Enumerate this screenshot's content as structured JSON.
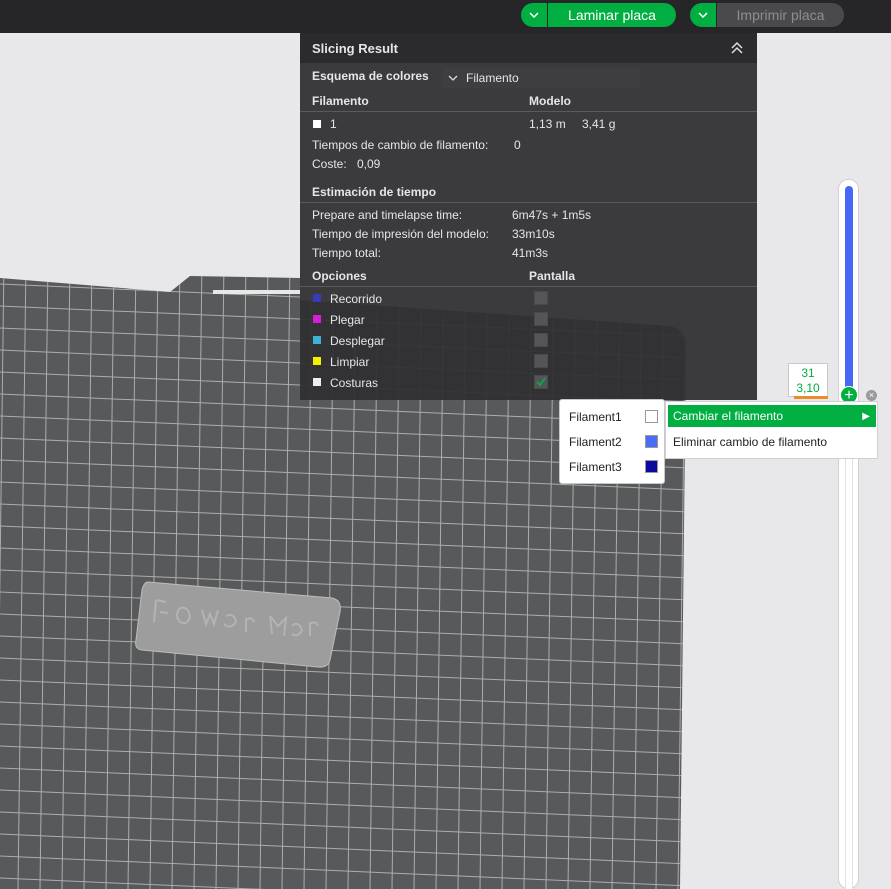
{
  "toolbar": {
    "slice_label": "Laminar placa",
    "print_label": "Imprimir placa"
  },
  "panel": {
    "title": "Slicing Result",
    "color_scheme_label": "Esquema de colores",
    "color_scheme_value": "Filamento",
    "filament_header": "Filamento",
    "model_header": "Modelo",
    "filament_rows": [
      {
        "index": "1",
        "length": "1,13 m",
        "weight": "3,41 g",
        "color": "#ffffff"
      }
    ],
    "change_count_label": "Tiempos de cambio de filamento:",
    "change_count_value": "0",
    "cost_label": "Coste:",
    "cost_value": "0,09",
    "time_section_title": "Estimación de tiempo",
    "times": [
      {
        "label": "Prepare and timelapse time:",
        "value": "6m47s + 1m5s"
      },
      {
        "label": "Tiempo de impresión del modelo:",
        "value": "33m10s"
      },
      {
        "label": "Tiempo total:",
        "value": "41m3s"
      }
    ],
    "options_header": "Opciones",
    "display_header": "Pantalla",
    "options": [
      {
        "label": "Recorrido",
        "color": "#3a3ab8",
        "checked": false
      },
      {
        "label": "Plegar",
        "color": "#d41fd4",
        "checked": false
      },
      {
        "label": "Desplegar",
        "color": "#3fb0d6",
        "checked": false
      },
      {
        "label": "Limpiar",
        "color": "#f2f200",
        "checked": false
      },
      {
        "label": "Costuras",
        "color": "#eeeeee",
        "checked": true
      }
    ]
  },
  "filament_menu": {
    "items": [
      {
        "label": "Filament1",
        "color": "#ffffff"
      },
      {
        "label": "Filament2",
        "color": "#4a6cf7"
      },
      {
        "label": "Filament3",
        "color": "#0a0aa0"
      }
    ]
  },
  "submenu": {
    "change_label": "Cambiar el filamento",
    "remove_label": "Eliminar cambio de filamento"
  },
  "layer_slider": {
    "layer": "31",
    "height": "3,10"
  },
  "colors": {
    "accent": "#00ae42",
    "slider_blue": "#4668f5",
    "plate": "#5a5b5c"
  }
}
